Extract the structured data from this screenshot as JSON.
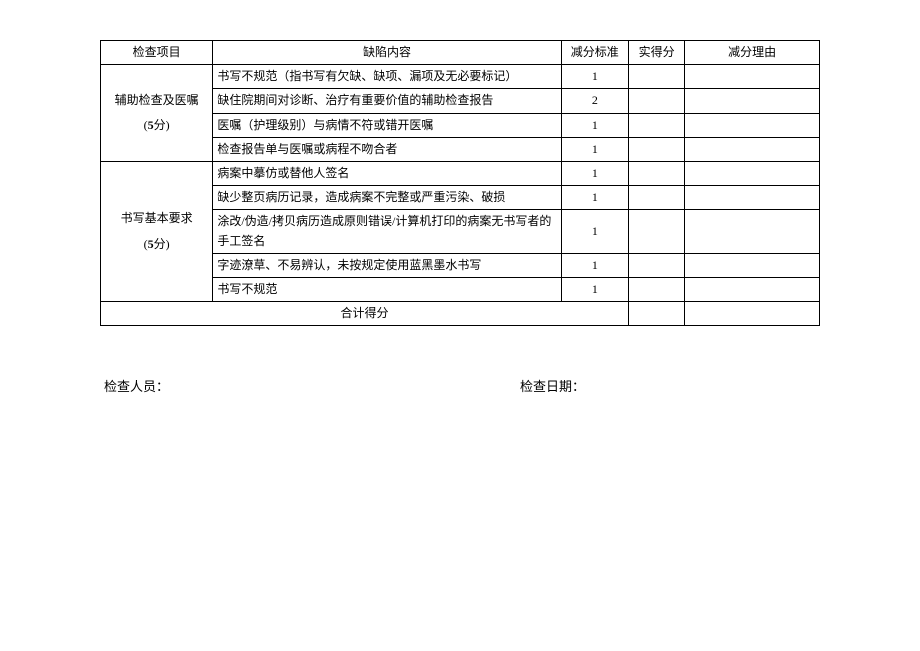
{
  "headers": {
    "item": "检查项目",
    "defect": "缺陷内容",
    "std": "减分标准",
    "score": "实得分",
    "reason": "减分理由"
  },
  "sections": [
    {
      "title": "辅助检查及医嘱",
      "points_label_prefix": "(",
      "points_value": "5",
      "points_unit": "分",
      "points_label_suffix": ")",
      "rows": [
        {
          "defect": "书写不规范（指书写有欠缺、缺项、漏项及无必要标记）",
          "std": "1",
          "score": "",
          "reason": ""
        },
        {
          "defect": "缺住院期间对诊断、治疗有重要价值的辅助检查报告",
          "std": "2",
          "score": "",
          "reason": ""
        },
        {
          "defect": "医嘱（护理级别）与病情不符或错开医嘱",
          "std": "1",
          "score": "",
          "reason": ""
        },
        {
          "defect": "检查报告单与医嘱或病程不吻合者",
          "std": "1",
          "score": "",
          "reason": ""
        }
      ]
    },
    {
      "title": "书写基本要求",
      "points_label_prefix": "(",
      "points_value": "5",
      "points_unit": "分",
      "points_label_suffix": ")",
      "rows": [
        {
          "defect": "病案中摹仿或替他人签名",
          "std": "1",
          "score": "",
          "reason": ""
        },
        {
          "defect": "缺少整页病历记录，造成病案不完整或严重污染、破损",
          "std": "1",
          "score": "",
          "reason": ""
        },
        {
          "defect": "涂改/伪造/拷贝病历造成原则错误/计算机打印的病案无书写者的手工签名",
          "std": "1",
          "score": "",
          "reason": ""
        },
        {
          "defect": "字迹潦草、不易辨认，未按规定使用蓝黑墨水书写",
          "std": "1",
          "score": "",
          "reason": ""
        },
        {
          "defect": "书写不规范",
          "std": "1",
          "score": "",
          "reason": ""
        }
      ]
    }
  ],
  "total_label": "合计得分",
  "total_score": "",
  "total_reason": "",
  "footer": {
    "checker_label": "检查人员：",
    "checker_value": "",
    "date_label": "检查日期：",
    "date_value": ""
  }
}
